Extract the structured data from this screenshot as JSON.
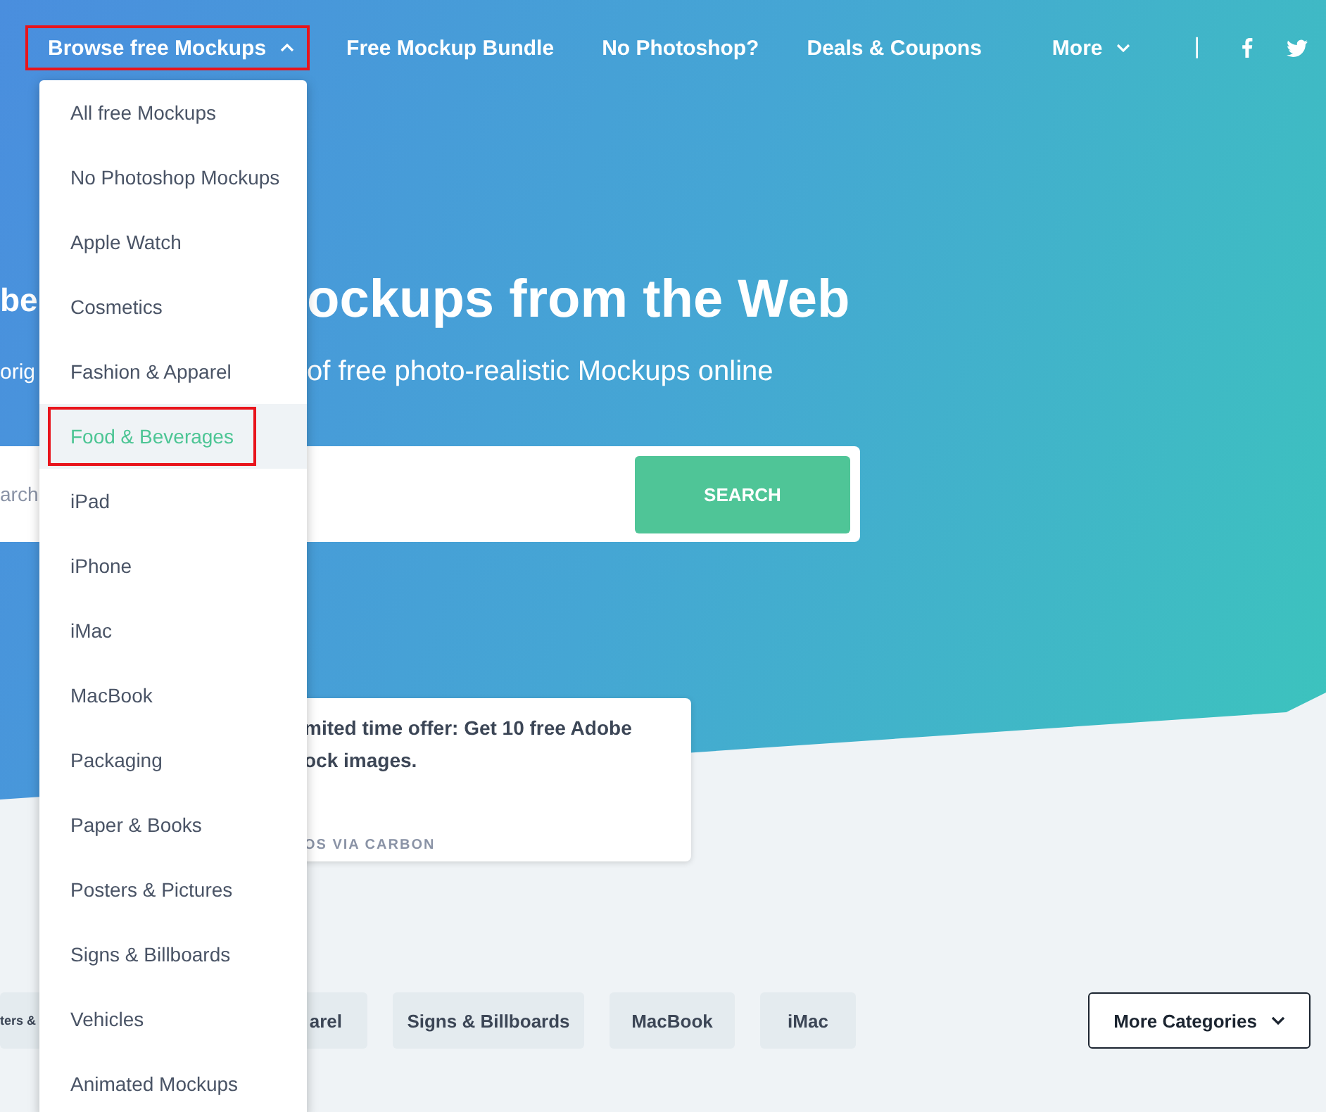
{
  "nav": {
    "items": [
      {
        "label": "Browse free Mockups",
        "kind": "dropdown",
        "expanded": true,
        "highlighted": true
      },
      {
        "label": "Free Mockup Bundle",
        "kind": "link"
      },
      {
        "label": "No Photoshop?",
        "kind": "link"
      },
      {
        "label": "Deals & Coupons",
        "kind": "link"
      },
      {
        "label": "More",
        "kind": "dropdown",
        "expanded": false,
        "highlighted": false
      },
      {
        "label": "|",
        "kind": "separator"
      }
    ]
  },
  "dropdown_menu": {
    "items": [
      {
        "label": "All free Mockups",
        "selected": false,
        "highlighted": false
      },
      {
        "label": "No Photoshop Mockups",
        "selected": false,
        "highlighted": false
      },
      {
        "label": "Apple Watch",
        "selected": false,
        "highlighted": false
      },
      {
        "label": "Cosmetics",
        "selected": false,
        "highlighted": false
      },
      {
        "label": "Fashion & Apparel",
        "selected": false,
        "highlighted": false
      },
      {
        "label": "Food & Beverages",
        "selected": true,
        "highlighted": true
      },
      {
        "label": "iPad",
        "selected": false,
        "highlighted": false
      },
      {
        "label": "iPhone",
        "selected": false,
        "highlighted": false
      },
      {
        "label": "iMac",
        "selected": false,
        "highlighted": false
      },
      {
        "label": "MacBook",
        "selected": false,
        "highlighted": false
      },
      {
        "label": "Packaging",
        "selected": false,
        "highlighted": false
      },
      {
        "label": "Paper & Books",
        "selected": false,
        "highlighted": false
      },
      {
        "label": "Posters & Pictures",
        "selected": false,
        "highlighted": false
      },
      {
        "label": "Signs & Billboards",
        "selected": false,
        "highlighted": false
      },
      {
        "label": "Vehicles",
        "selected": false,
        "highlighted": false
      },
      {
        "label": "Animated Mockups",
        "selected": false,
        "highlighted": false
      }
    ]
  },
  "hero": {
    "heading": [
      "be",
      "ockups from the Web"
    ],
    "subtitle": [
      "orig",
      "of free photo-realistic Mockups online"
    ],
    "search": {
      "placeholder": "arch",
      "button": "SEARCH"
    }
  },
  "ad": {
    "lines": [
      "mited time offer: Get 10 free Adobe",
      "ock images."
    ],
    "footer": "OS VIA CARBON"
  },
  "categories": {
    "chips": [
      "ters &",
      "arel",
      "Signs & Billboards",
      "MacBook",
      "iMac"
    ],
    "more_button": "More Categories"
  }
}
